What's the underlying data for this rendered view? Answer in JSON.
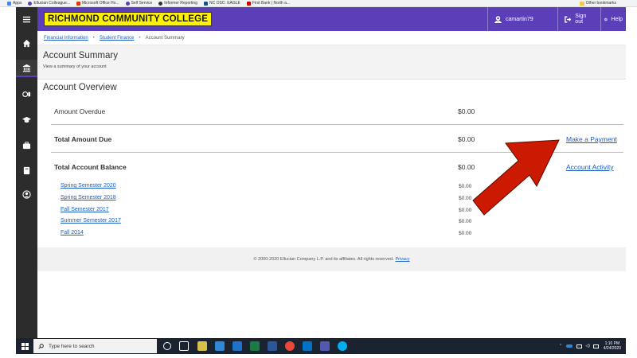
{
  "bookmarks": {
    "items": [
      {
        "label": "Apps",
        "color": "#4285f4"
      },
      {
        "label": "Ellucian Colleague...",
        "color": "#5b3fb8"
      },
      {
        "label": "Microsoft Office Ho...",
        "color": "#d83b01"
      },
      {
        "label": "Self Service",
        "color": "#5b3fb8"
      },
      {
        "label": "Informer Reporting",
        "color": "#333333"
      },
      {
        "label": "NC OSC: EAGLE",
        "color": "#1b4f8a"
      },
      {
        "label": "First Bank | North a...",
        "color": "#c00000"
      }
    ],
    "other": "Other bookmarks"
  },
  "header": {
    "brand": "RICHMOND COMMUNITY COLLEGE",
    "user": "camartin79",
    "signout": "Sign out",
    "help": "Help",
    "color": "#5b3fb8"
  },
  "breadcrumb": {
    "items": [
      "Financial Information",
      "Student Finance",
      "Account Summary"
    ]
  },
  "page": {
    "title": "Account Summary",
    "subtitle": "View a summary of your account"
  },
  "overview": {
    "title": "Account Overview",
    "rows": [
      {
        "label": "Amount Overdue",
        "amount": "$0.00",
        "action": ""
      },
      {
        "label": "Total Amount Due",
        "amount": "$0.00",
        "action": "Make a Payment"
      },
      {
        "label": "Total Account Balance",
        "amount": "$0.00",
        "action": "Account Activity"
      }
    ],
    "terms": [
      {
        "name": "Spring Semester 2020",
        "amount": "$0.00"
      },
      {
        "name": "Spring Semester 2018",
        "amount": "$0.00"
      },
      {
        "name": "Fall Semester 2017",
        "amount": "$0.00"
      },
      {
        "name": "Summer Semester 2017",
        "amount": "$0.00"
      },
      {
        "name": "Fall 2014",
        "amount": "$0.00"
      }
    ]
  },
  "footer": {
    "text": "© 2000-2020 Ellucian Company L.P. and its affiliates. All rights reserved.",
    "privacy": "Privacy"
  },
  "taskbar": {
    "search_placeholder": "Type here to search",
    "time": "1:10 PM",
    "date": "4/24/2020"
  },
  "annotation": {
    "arrow_color": "#cc1a00"
  }
}
